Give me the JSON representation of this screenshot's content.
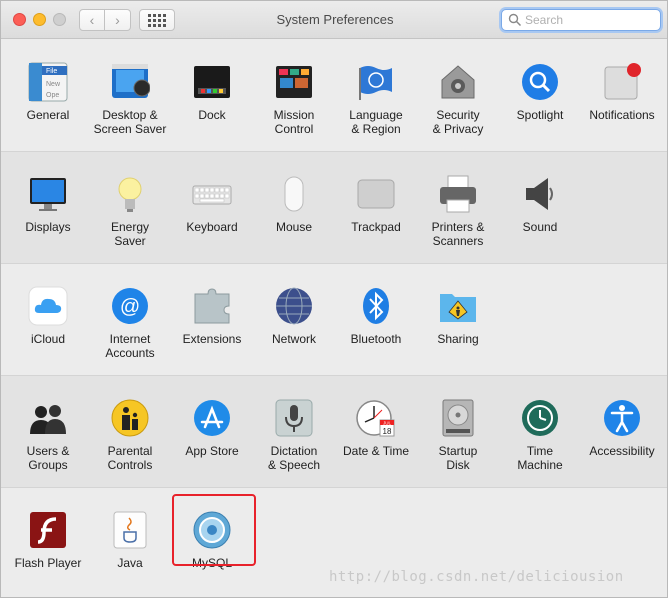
{
  "window": {
    "title": "System Preferences"
  },
  "search": {
    "placeholder": "Search"
  },
  "rows": [
    [
      {
        "label": "General",
        "icon": "general-icon"
      },
      {
        "label": "Desktop &\nScreen Saver",
        "icon": "desktop-screensaver-icon"
      },
      {
        "label": "Dock",
        "icon": "dock-icon"
      },
      {
        "label": "Mission\nControl",
        "icon": "mission-control-icon"
      },
      {
        "label": "Language\n& Region",
        "icon": "language-region-icon"
      },
      {
        "label": "Security\n& Privacy",
        "icon": "security-privacy-icon"
      },
      {
        "label": "Spotlight",
        "icon": "spotlight-icon"
      },
      {
        "label": "Notifications",
        "icon": "notifications-icon"
      }
    ],
    [
      {
        "label": "Displays",
        "icon": "displays-icon"
      },
      {
        "label": "Energy\nSaver",
        "icon": "energy-saver-icon"
      },
      {
        "label": "Keyboard",
        "icon": "keyboard-icon"
      },
      {
        "label": "Mouse",
        "icon": "mouse-icon"
      },
      {
        "label": "Trackpad",
        "icon": "trackpad-icon"
      },
      {
        "label": "Printers &\nScanners",
        "icon": "printers-scanners-icon"
      },
      {
        "label": "Sound",
        "icon": "sound-icon"
      }
    ],
    [
      {
        "label": "iCloud",
        "icon": "icloud-icon"
      },
      {
        "label": "Internet\nAccounts",
        "icon": "internet-accounts-icon"
      },
      {
        "label": "Extensions",
        "icon": "extensions-icon"
      },
      {
        "label": "Network",
        "icon": "network-icon"
      },
      {
        "label": "Bluetooth",
        "icon": "bluetooth-icon"
      },
      {
        "label": "Sharing",
        "icon": "sharing-icon"
      }
    ],
    [
      {
        "label": "Users &\nGroups",
        "icon": "users-groups-icon"
      },
      {
        "label": "Parental\nControls",
        "icon": "parental-controls-icon"
      },
      {
        "label": "App Store",
        "icon": "app-store-icon"
      },
      {
        "label": "Dictation\n& Speech",
        "icon": "dictation-speech-icon"
      },
      {
        "label": "Date & Time",
        "icon": "date-time-icon"
      },
      {
        "label": "Startup\nDisk",
        "icon": "startup-disk-icon"
      },
      {
        "label": "Time\nMachine",
        "icon": "time-machine-icon"
      },
      {
        "label": "Accessibility",
        "icon": "accessibility-icon"
      }
    ],
    [
      {
        "label": "Flash Player",
        "icon": "flash-player-icon"
      },
      {
        "label": "Java",
        "icon": "java-icon"
      },
      {
        "label": "MySQL",
        "icon": "mysql-icon"
      }
    ]
  ],
  "icon_text": {
    "general_file": "File",
    "general_new": "New",
    "general_ope": "Ope",
    "date_month": "JUL",
    "date_day": "18"
  },
  "watermark": "http://blog.csdn.net/deliciousion",
  "colors": {
    "highlight": "#e8222b",
    "notification_dot": "#e0242a",
    "search_focus": "#7aa9e8"
  }
}
